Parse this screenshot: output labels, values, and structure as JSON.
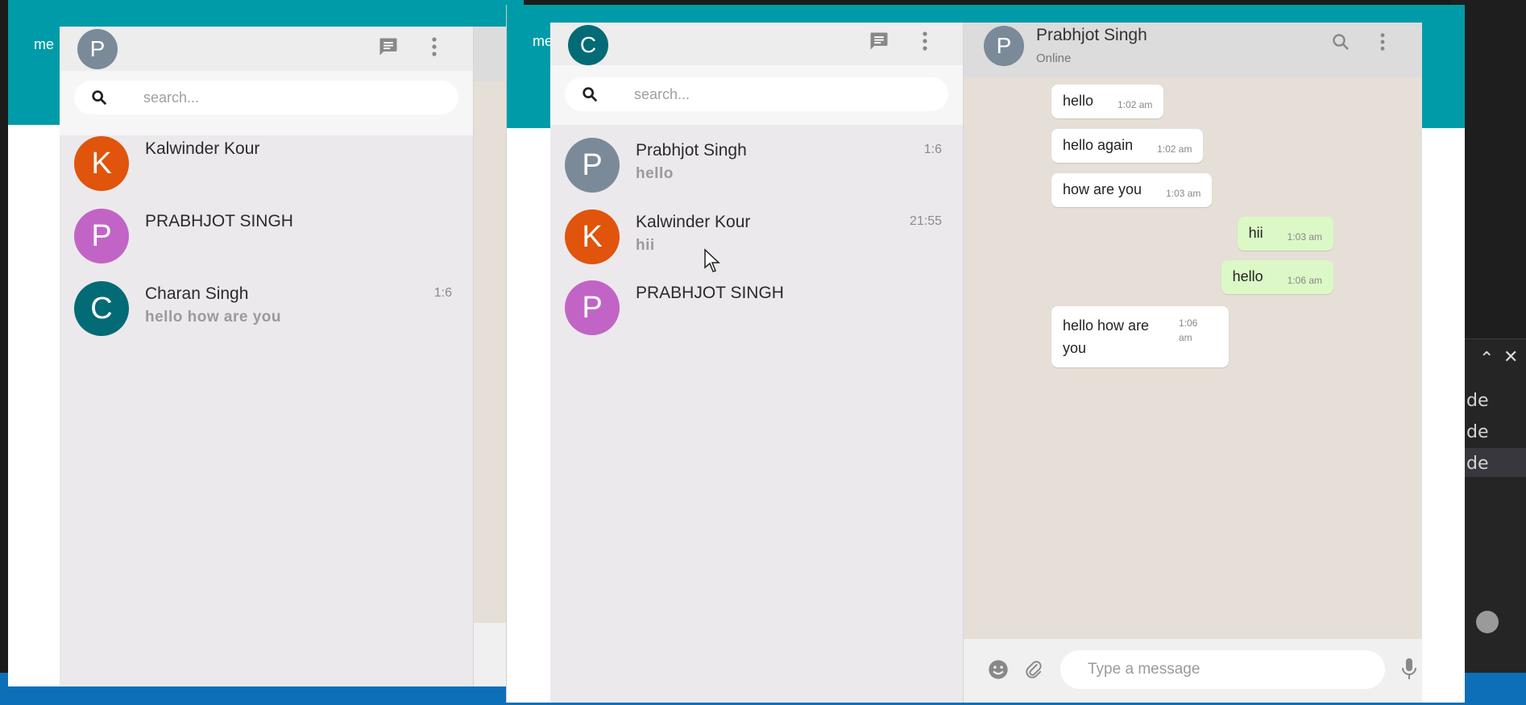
{
  "colors": {
    "teal_band": "#009ba8",
    "avatar_p_grey": "#7a8a98",
    "avatar_k": "#e0540c",
    "avatar_p_purple": "#c164c6",
    "avatar_c": "#036b75",
    "outgoing_bubble": "#dcf8c6"
  },
  "left_window": {
    "tab_label": "me",
    "user_avatar_letter": "P",
    "search_placeholder": "search...",
    "contacts": [
      {
        "letter": "K",
        "name": "Kalwinder Kour",
        "last_message": "",
        "time": ""
      },
      {
        "letter": "P",
        "name": "PRABHJOT SINGH",
        "last_message": "",
        "time": ""
      },
      {
        "letter": "C",
        "name": "Charan Singh",
        "last_message": "hello how are you",
        "time": "1:6"
      }
    ]
  },
  "right_window": {
    "tab_label": "me",
    "user_avatar_letter": "C",
    "search_placeholder": "search...",
    "contacts": [
      {
        "letter": "P",
        "name": "Prabhjot Singh",
        "last_message": "hello",
        "time": "1:6"
      },
      {
        "letter": "K",
        "name": "Kalwinder Kour",
        "last_message": "hii",
        "time": "21:55"
      },
      {
        "letter": "P",
        "name": "PRABHJOT SINGH",
        "last_message": "",
        "time": ""
      }
    ],
    "chat": {
      "contact_letter": "P",
      "contact_name": "Prabhjot Singh",
      "status": "Online",
      "messages": [
        {
          "direction": "in",
          "text": "hello",
          "time": "1:02 am"
        },
        {
          "direction": "in",
          "text": "hello again",
          "time": "1:02 am"
        },
        {
          "direction": "in",
          "text": "how are you",
          "time": "1:03 am"
        },
        {
          "direction": "out",
          "text": "hii",
          "time": "1:03 am"
        },
        {
          "direction": "out",
          "text": "hello",
          "time": "1:06 am"
        },
        {
          "direction": "in",
          "text": "hello how are you",
          "time": "1:06 am"
        }
      ],
      "input_placeholder": "Type a message"
    }
  },
  "background_editor": {
    "lines": [
      "de",
      "de",
      "de"
    ]
  },
  "icons": {
    "chat": "chat-icon",
    "menu": "more-vertical-icon",
    "search": "search-icon",
    "emoji": "emoji-icon",
    "attach": "paperclip-icon",
    "mic": "microphone-icon"
  }
}
